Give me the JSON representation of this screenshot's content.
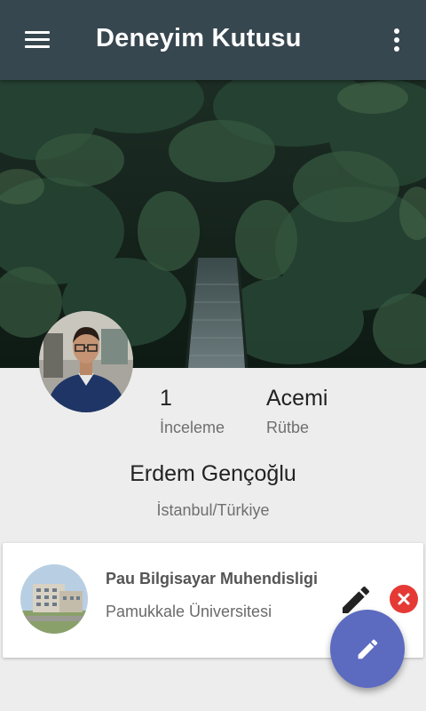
{
  "appbar": {
    "title": "Deneyim Kutusu",
    "menu_icon": "hamburger-menu-icon",
    "more_icon": "more-vertical-icon"
  },
  "profile": {
    "name": "Erdem Gençoğlu",
    "location": "İstanbul/Türkiye",
    "stats": {
      "reviews_value": "1",
      "reviews_label": "İnceleme",
      "rank_value": "Acemi",
      "rank_label": "Rütbe"
    }
  },
  "education_card": {
    "title": "Pau Bilgisayar Muhendisligi",
    "subtitle": "Pamukkale Üniversitesi",
    "edit_icon": "pencil-icon",
    "delete_icon": "close-circle-icon"
  },
  "fab": {
    "icon": "pencil-icon"
  },
  "colors": {
    "appbar": "#37474f",
    "fab": "#5c6bc0",
    "delete": "#e53935",
    "background": "#ededed"
  }
}
